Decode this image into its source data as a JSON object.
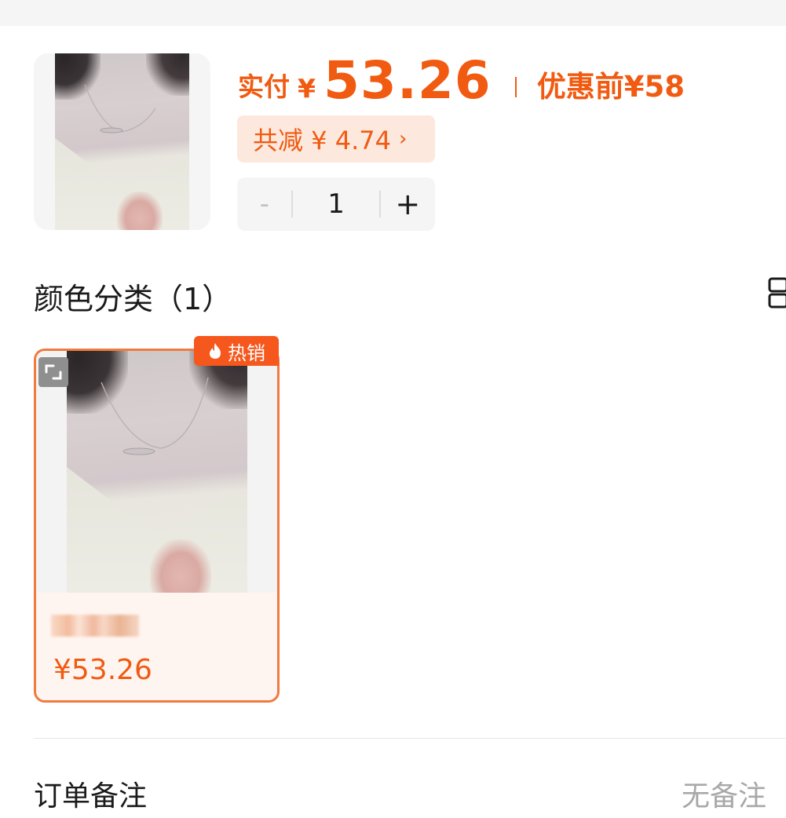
{
  "price": {
    "paid_label": "实付",
    "currency": "¥",
    "paid_value": "53.26",
    "original_label": "优惠前¥58",
    "discount_text": "共减 ¥ 4.74",
    "discount_chevron": "›"
  },
  "quantity": {
    "minus_symbol": "-",
    "value": "1",
    "plus_symbol": "+"
  },
  "sku_section": {
    "title": "颜色分类（1）",
    "card": {
      "hot_badge": "热销",
      "price": "¥53.26"
    }
  },
  "order_note": {
    "label": "订单备注",
    "value": "无备注"
  },
  "colors": {
    "accent": "#f15a11",
    "badge_bg": "#fde8de",
    "hot_badge": "#f5571c"
  },
  "icons": [
    "fire-icon",
    "expand-icon",
    "grid-view-icon",
    "chevron-right-icon"
  ]
}
